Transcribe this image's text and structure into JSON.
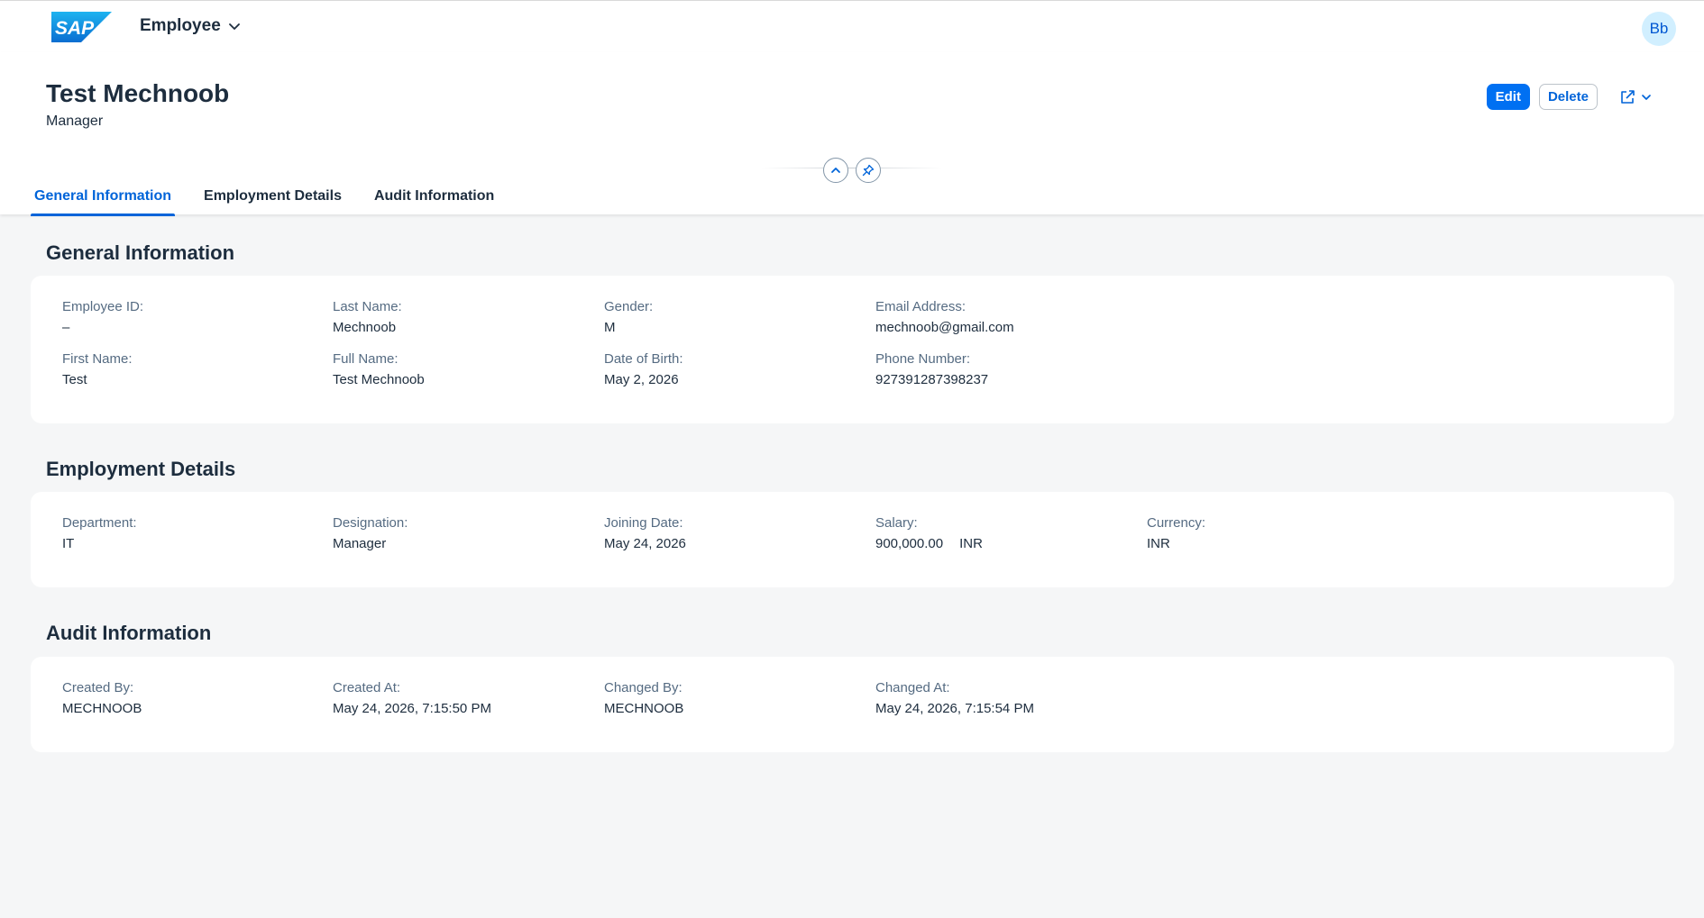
{
  "shell": {
    "logo_text": "SAP",
    "app_title": "Employee",
    "avatar_initials": "Bb"
  },
  "header": {
    "title": "Test Mechnoob",
    "subtitle": "Manager",
    "actions": {
      "edit": "Edit",
      "delete": "Delete"
    }
  },
  "tabs": [
    {
      "label": "General Information",
      "active": true
    },
    {
      "label": "Employment Details",
      "active": false
    },
    {
      "label": "Audit Information",
      "active": false
    }
  ],
  "sections": {
    "general": {
      "title": "General Information",
      "fields": {
        "employee_id": {
          "label": "Employee ID:",
          "value": "–"
        },
        "last_name": {
          "label": "Last Name:",
          "value": "Mechnoob"
        },
        "gender": {
          "label": "Gender:",
          "value": "M"
        },
        "email": {
          "label": "Email Address:",
          "value": "mechnoob@gmail.com"
        },
        "first_name": {
          "label": "First Name:",
          "value": "Test"
        },
        "full_name": {
          "label": "Full Name:",
          "value": "Test Mechnoob"
        },
        "dob": {
          "label": "Date of Birth:",
          "value": "May 2, 2026"
        },
        "phone": {
          "label": "Phone Number:",
          "value": "927391287398237"
        }
      }
    },
    "employment": {
      "title": "Employment Details",
      "fields": {
        "department": {
          "label": "Department:",
          "value": "IT"
        },
        "designation": {
          "label": "Designation:",
          "value": "Manager"
        },
        "joining_date": {
          "label": "Joining Date:",
          "value": "May 24, 2026"
        },
        "salary": {
          "label": "Salary:",
          "value": "900,000.00",
          "unit": "INR"
        },
        "currency": {
          "label": "Currency:",
          "value": "INR"
        }
      }
    },
    "audit": {
      "title": "Audit Information",
      "fields": {
        "created_by": {
          "label": "Created By:",
          "value": "MECHNOOB"
        },
        "created_at": {
          "label": "Created At:",
          "value": "May 24, 2026, 7:15:50 PM"
        },
        "changed_by": {
          "label": "Changed By:",
          "value": "MECHNOOB"
        },
        "changed_at": {
          "label": "Changed At:",
          "value": "May 24, 2026, 7:15:54 PM"
        }
      }
    }
  },
  "icons": {
    "app_menu": "chevron-down-icon",
    "collapse_header": "chevron-up-icon",
    "pin_header": "pin-icon",
    "share": "share-icon"
  },
  "colors": {
    "brand_blue": "#0070f2",
    "link_blue": "#0064d9",
    "page_bg": "#f5f6f7",
    "label_gray": "#556b82",
    "text_dark": "#1d2d3e"
  }
}
